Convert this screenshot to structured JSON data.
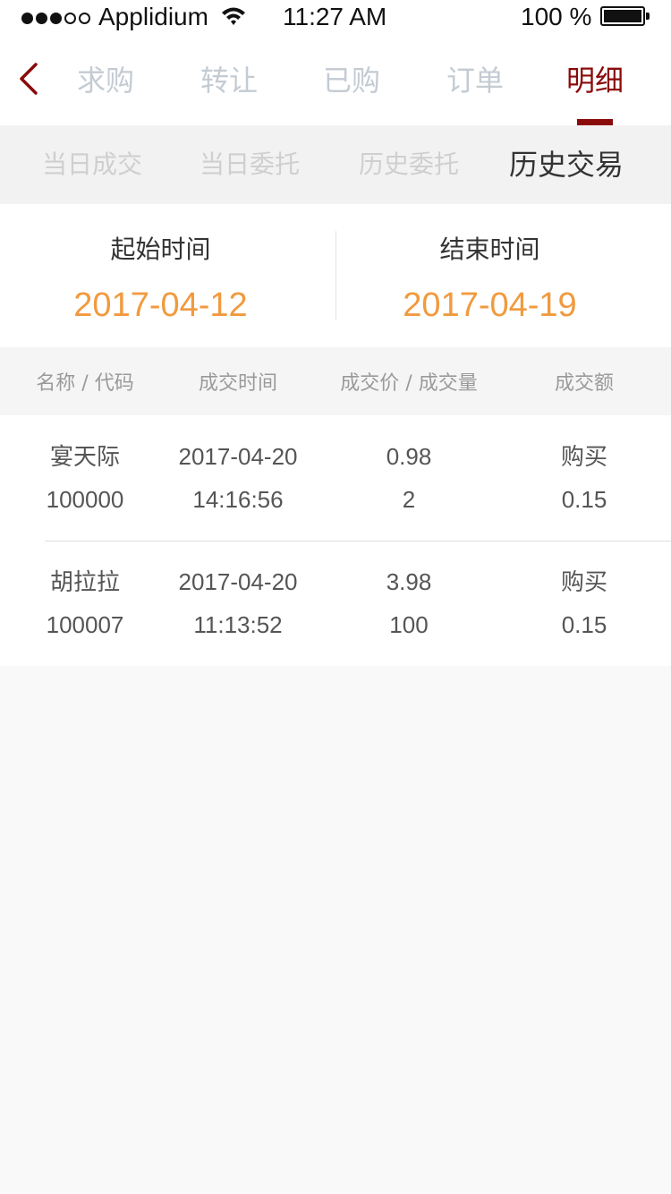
{
  "status_bar": {
    "carrier": "Applidium",
    "time": "11:27 AM",
    "battery_percent": "100 %",
    "signal_bars_filled": 3,
    "signal_bars_total": 5
  },
  "nav": {
    "back_icon": "chevron-left-icon",
    "tabs": [
      {
        "label": "求购",
        "active": false
      },
      {
        "label": "转让",
        "active": false
      },
      {
        "label": "已购",
        "active": false
      },
      {
        "label": "订单",
        "active": false
      },
      {
        "label": "明细",
        "active": true
      }
    ]
  },
  "sub_tabs": [
    {
      "label": "当日成交",
      "active": false
    },
    {
      "label": "当日委托",
      "active": false
    },
    {
      "label": "历史委托",
      "active": false
    },
    {
      "label": "历史交易",
      "active": true
    }
  ],
  "date_range": {
    "start_label": "起始时间",
    "start_value": "2017-04-12",
    "end_label": "结束时间",
    "end_value": "2017-04-19"
  },
  "table": {
    "headers": [
      "名称 / 代码",
      "成交时间",
      "成交价 / 成交量",
      "成交额"
    ],
    "rows": [
      {
        "name": "宴天际",
        "code": "100000",
        "date": "2017-04-20",
        "time": "14:16:56",
        "price": "0.98",
        "volume": "2",
        "type": "购买",
        "amount": "0.15"
      },
      {
        "name": "胡拉拉",
        "code": "100007",
        "date": "2017-04-20",
        "time": "11:13:52",
        "price": "3.98",
        "volume": "100",
        "type": "购买",
        "amount": "0.15"
      }
    ]
  },
  "colors": {
    "accent": "#8b0a0a",
    "date_value": "#f19a3e",
    "inactive_tab": "#c4cbd3",
    "inactive_subtab": "#cfcfcf",
    "page_bg": "#f9f9f9"
  }
}
